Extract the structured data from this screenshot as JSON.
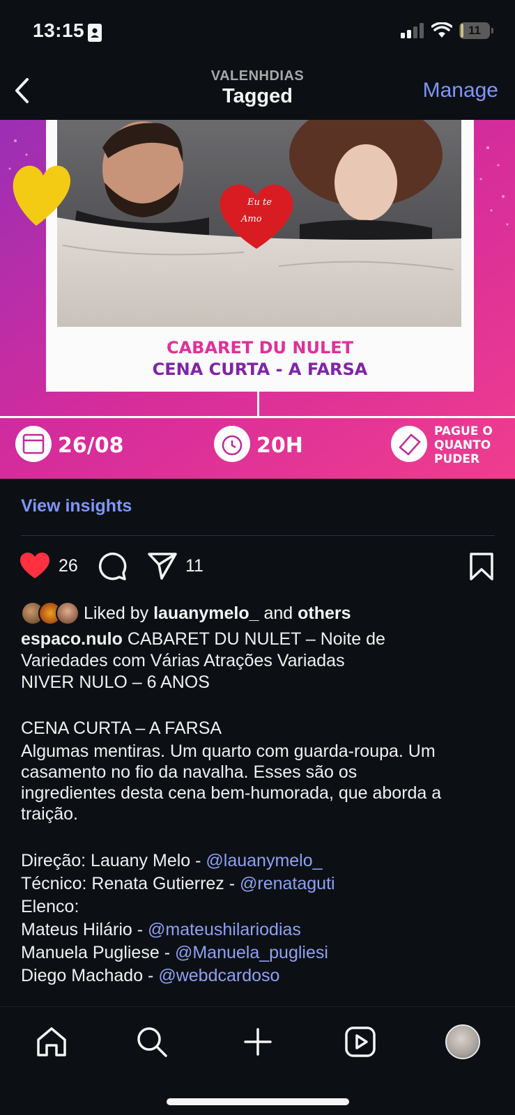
{
  "status": {
    "time": "13:15",
    "battery": "11",
    "battery_level": 0.11
  },
  "nav": {
    "subtitle": "VALENHDIAS",
    "title": "Tagged",
    "manage": "Manage"
  },
  "post": {
    "poster": {
      "heart_note": [
        "Eu te",
        "Amo"
      ],
      "line1": "CABARET DU NULET",
      "line2": "CENA CURTA - A FARSA",
      "date": "26/08",
      "time": "20H",
      "price": [
        "PAGUE O",
        "QUANTO",
        "PUDER"
      ]
    },
    "insights": "View insights",
    "likes_count": "26",
    "shares_count": "11",
    "liked_by": {
      "prefix": "Liked by",
      "user": "lauanymelo_",
      "middle": "and",
      "others": "others"
    },
    "caption": {
      "username": "espaco.nulo",
      "line1": "CABARET DU NULET – Noite de",
      "line2": "Variedades com Várias Atrações Variadas",
      "line3": "NIVER NULO – 6 ANOS",
      "line4": "CENA CURTA – A FARSA",
      "line5": "Algumas mentiras. Um quarto com guarda-roupa. Um",
      "line6": "casamento no fio da navalha. Esses são os",
      "line7": "ingredientes desta cena bem-humorada, que aborda a",
      "line8": "traição.",
      "credits": [
        {
          "label": "Direção: Lauany Melo - ",
          "mention": "@lauanymelo_"
        },
        {
          "label": "Técnico: Renata Gutierrez - ",
          "mention": "@renataguti"
        },
        {
          "label": "Elenco:",
          "mention": ""
        },
        {
          "label": "Mateus Hilário - ",
          "mention": "@mateushilariodias"
        },
        {
          "label": "Manuela Pugliese - ",
          "mention": "@Manuela_pugliesi"
        },
        {
          "label": "Diego Machado - ",
          "mention": "@webdcardoso"
        }
      ]
    }
  },
  "colors": {
    "background": "#0c1014",
    "link": "#7e96f7",
    "like": "#ff3040",
    "poster_magenta": "#e0309a",
    "poster_purple": "#8a2db0"
  },
  "icons": {
    "tabs": [
      "home-icon",
      "search-icon",
      "create-icon",
      "reels-icon",
      "profile-avatar"
    ]
  }
}
